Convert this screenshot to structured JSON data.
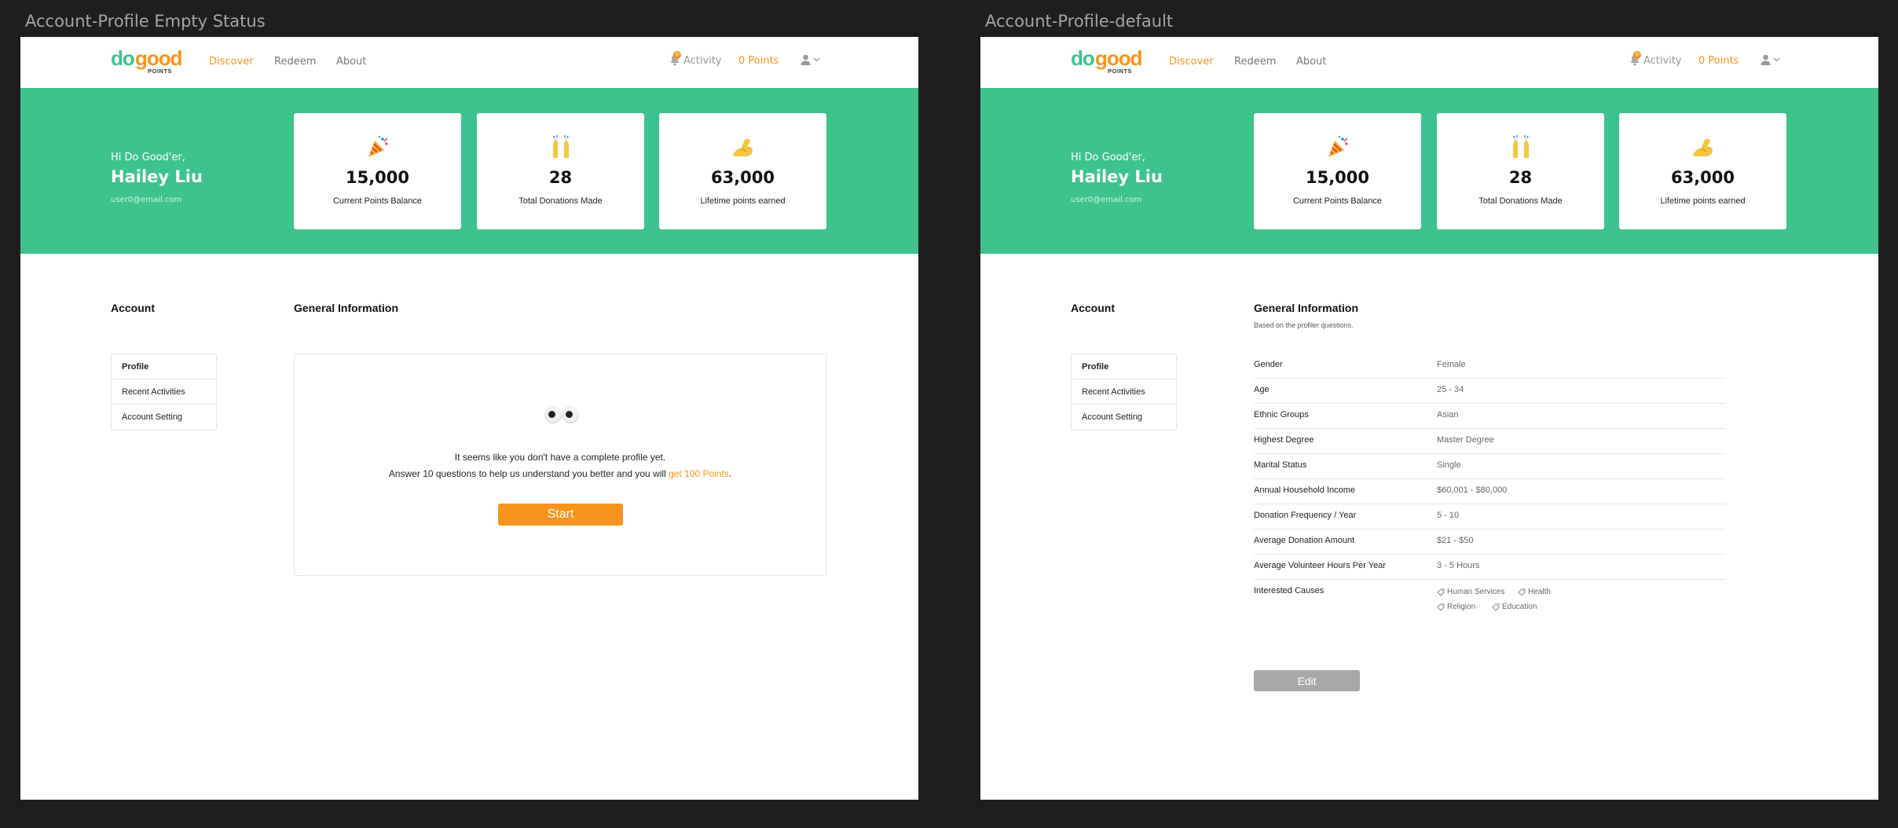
{
  "frames": [
    {
      "title": "Account-Profile Empty Status"
    },
    {
      "title": "Account-Profile-default"
    }
  ],
  "nav": {
    "logo_do": "do",
    "logo_good": "good",
    "logo_points": "POINTS",
    "discover": "Discover",
    "redeem": "Redeem",
    "about": "About",
    "activity": "Activity",
    "activity_badge": "0",
    "points": "0 Points"
  },
  "hero": {
    "greeting": "Hi Do Good'er,",
    "name": "Hailey Liu",
    "email": "user0@email.com",
    "stats": [
      {
        "icon": "party-popper-icon",
        "value": "15,000",
        "label": "Current Points Balance"
      },
      {
        "icon": "raised-hands-icon",
        "value": "28",
        "label": "Total Donations Made"
      },
      {
        "icon": "flexed-biceps-icon",
        "value": "63,000",
        "label": "Lifetime points earned"
      }
    ]
  },
  "account": {
    "heading": "Account",
    "menu": [
      "Profile",
      "Recent Activities",
      "Account Setting"
    ]
  },
  "general": {
    "title": "General Information",
    "subtitle": "Based on the profiler questions."
  },
  "empty": {
    "line1": "It seems like you don't have a complete profile yet.",
    "line2_prefix": "Answer 10 questions to help us understand you better and you will ",
    "line2_link": "get 100 Points",
    "line2_suffix": ".",
    "start": "Start"
  },
  "profile": {
    "rows": [
      {
        "label": "Gender",
        "value": "Female"
      },
      {
        "label": "Age",
        "value": "25 - 34"
      },
      {
        "label": "Ethnic Groups",
        "value": "Asian"
      },
      {
        "label": "Highest Degree",
        "value": "Master Degree"
      },
      {
        "label": "Marital Status",
        "value": "Single"
      },
      {
        "label": "Annual Household Income",
        "value": "$60,001 - $80,000"
      },
      {
        "label": "Donation Frequency / Year",
        "value": "5 - 10"
      },
      {
        "label": "Average Donation Amount",
        "value": "$21 - $50"
      },
      {
        "label": "Average Volunteer Hours Per Year",
        "value": "3 - 5 Hours"
      }
    ],
    "causes_label": "Interested Causes",
    "causes": [
      "Human Services",
      "Health",
      "Religion",
      "Education"
    ],
    "edit": "Edit"
  },
  "colors": {
    "brand_green": "#3dc38d",
    "accent_orange": "#f7941d"
  }
}
